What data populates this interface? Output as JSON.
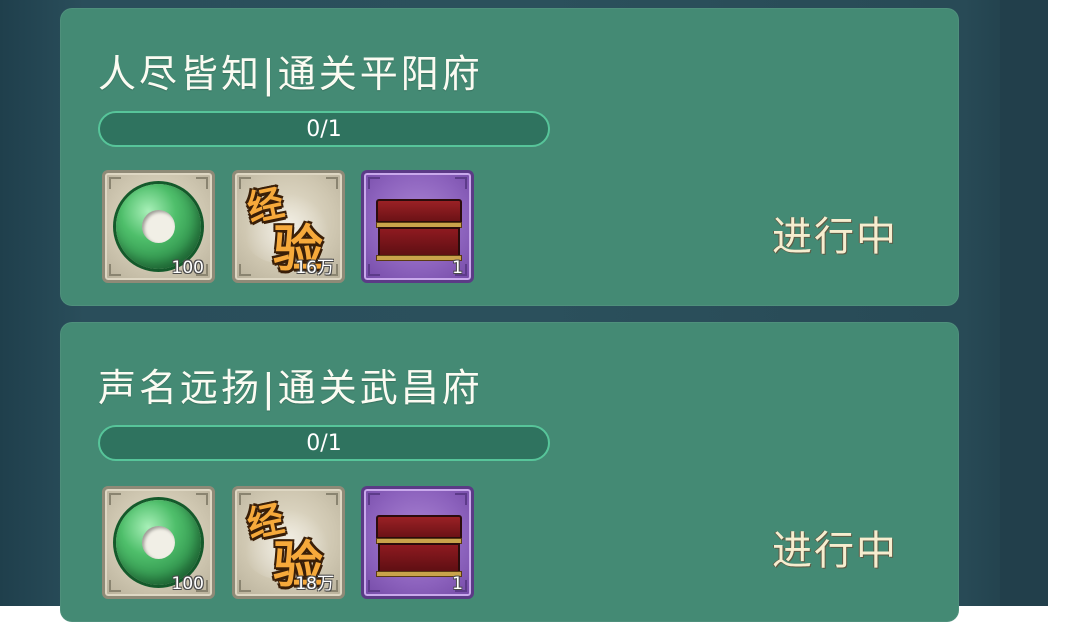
{
  "quests": [
    {
      "title": "人尽皆知|通关平阳府",
      "progress": {
        "text": "0/1",
        "fraction": 0
      },
      "status": "进行中",
      "rewards": [
        {
          "icon": "jade-coin-icon",
          "count": "100"
        },
        {
          "icon": "experience-icon",
          "label_top": "经",
          "label_bottom": "验",
          "count": "16万"
        },
        {
          "icon": "red-treasure-chest-icon",
          "count": "1"
        }
      ]
    },
    {
      "title": "声名远扬|通关武昌府",
      "progress": {
        "text": "0/1",
        "fraction": 0
      },
      "status": "进行中",
      "rewards": [
        {
          "icon": "jade-coin-icon",
          "count": "100"
        },
        {
          "icon": "experience-icon",
          "label_top": "经",
          "label_bottom": "验",
          "count": "18万"
        },
        {
          "icon": "red-treasure-chest-icon",
          "count": "1"
        }
      ]
    }
  ],
  "colors": {
    "card_bg": "#448a74",
    "progress_border": "#57c59a",
    "status_text": "#f6edcf",
    "rare_frame": "#8c62bd"
  }
}
